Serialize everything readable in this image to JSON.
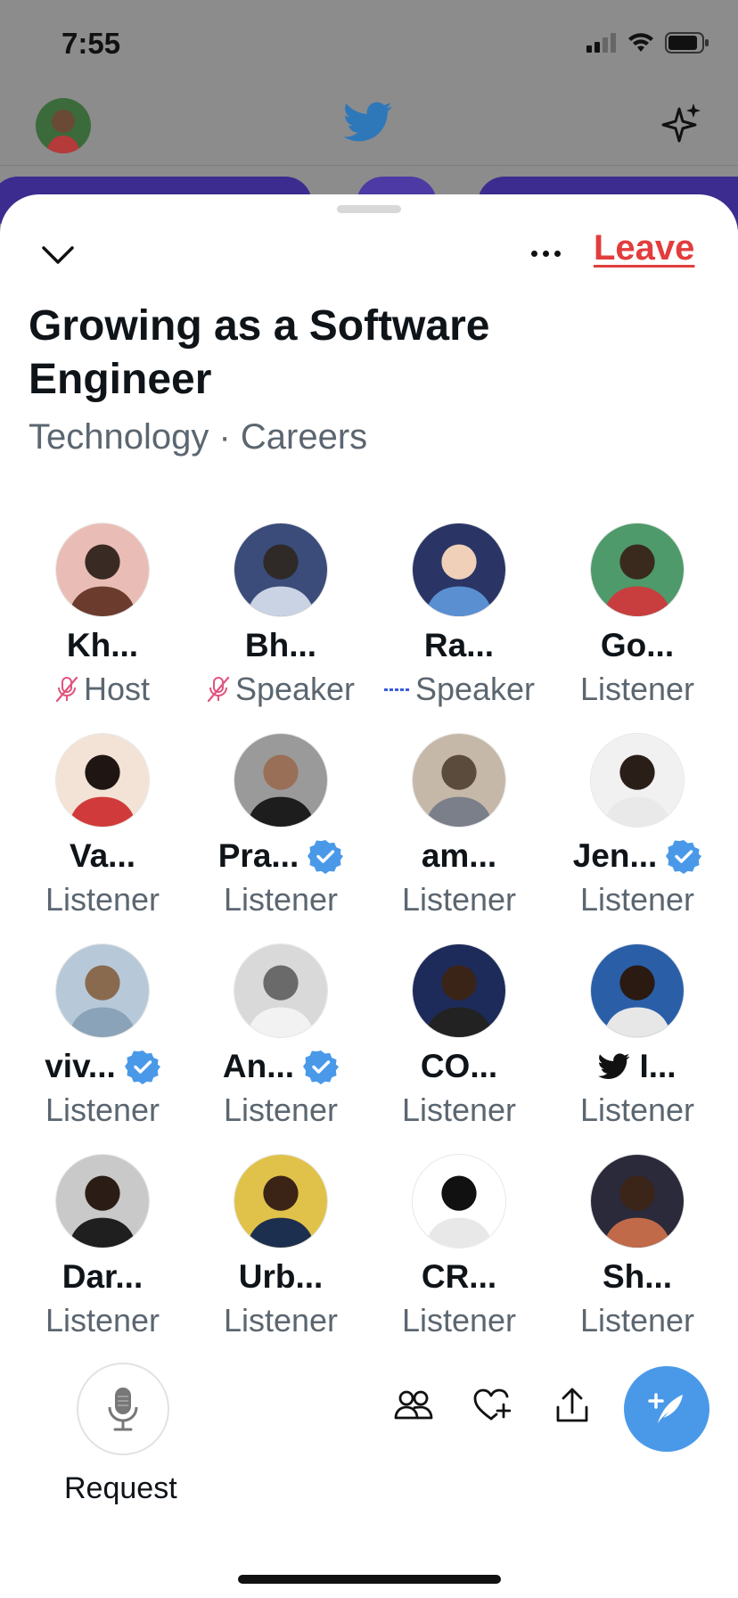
{
  "status_bar": {
    "time": "7:55"
  },
  "background": {
    "logo_icon": "twitter-bird-icon",
    "sparkle_icon": "sparkle-icon"
  },
  "space": {
    "title": "Growing as a Software Engineer",
    "topics": "Technology · Careers",
    "leave_label": "Leave",
    "collapse_icon": "chevron-down-icon",
    "more_icon": "more-horizontal-icon"
  },
  "participants": [
    {
      "name": "Kh...",
      "role": "Host",
      "role_icon": "mic-off-icon",
      "badge": ""
    },
    {
      "name": "Bh...",
      "role": "Speaker",
      "role_icon": "mic-off-icon",
      "badge": ""
    },
    {
      "name": "Ra...",
      "role": "Speaker",
      "role_icon": "speaking-dots-icon",
      "badge": ""
    },
    {
      "name": "Go...",
      "role": "Listener",
      "role_icon": "",
      "badge": ""
    },
    {
      "name": "Va...",
      "role": "Listener",
      "role_icon": "",
      "badge": ""
    },
    {
      "name": "Pra...",
      "role": "Listener",
      "role_icon": "",
      "badge": "verified"
    },
    {
      "name": "am...",
      "role": "Listener",
      "role_icon": "",
      "badge": ""
    },
    {
      "name": "Jen...",
      "role": "Listener",
      "role_icon": "",
      "badge": "verified"
    },
    {
      "name": "viv...",
      "role": "Listener",
      "role_icon": "",
      "badge": "verified"
    },
    {
      "name": "An...",
      "role": "Listener",
      "role_icon": "",
      "badge": "verified"
    },
    {
      "name": "CO...",
      "role": "Listener",
      "role_icon": "",
      "badge": ""
    },
    {
      "name": "I...",
      "role": "Listener",
      "role_icon": "",
      "badge": "twitter-bird"
    },
    {
      "name": "Dar...",
      "role": "Listener",
      "role_icon": "",
      "badge": ""
    },
    {
      "name": "Urb...",
      "role": "Listener",
      "role_icon": "",
      "badge": ""
    },
    {
      "name": "CR...",
      "role": "Listener",
      "role_icon": "",
      "badge": ""
    },
    {
      "name": "Sh...",
      "role": "Listener",
      "role_icon": "",
      "badge": ""
    }
  ],
  "bottom_bar": {
    "request_label": "Request",
    "request_icon": "microphone-icon",
    "people_icon": "people-icon",
    "react_icon": "heart-plus-icon",
    "share_icon": "share-icon",
    "compose_icon": "compose-tweet-icon"
  },
  "colors": {
    "leave": "#e23d3d",
    "verified": "#4a99e9",
    "compose": "#4a99e9",
    "muted": "#e0557f"
  }
}
